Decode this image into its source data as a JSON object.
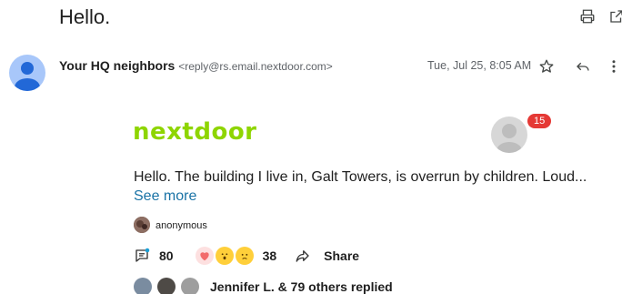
{
  "email": {
    "subject": "Hello.",
    "sender_name": "Your HQ neighbors",
    "sender_email": "<reply@rs.email.nextdoor.com>",
    "date": "Tue, Jul 25, 8:05 AM"
  },
  "icons": {
    "print": "print-icon",
    "open_new_window": "open-in-new-icon",
    "star": "star-icon",
    "reply": "reply-icon",
    "more": "more-vert-icon"
  },
  "nextdoor": {
    "logo_text": "nextdoor",
    "notification_count": "15",
    "post_text": "Hello. The building I live in, Galt Towers, is overrun by children. Loud...",
    "see_more": "See more",
    "author": "anonymous",
    "comment_count": "80",
    "reaction_count": "38",
    "share_label": "Share",
    "replies_text": "Jennifer L. & 79 others replied"
  },
  "colors": {
    "brand_green": "#8ed500",
    "link_blue": "#1a73a6",
    "badge_red": "#e53935"
  }
}
